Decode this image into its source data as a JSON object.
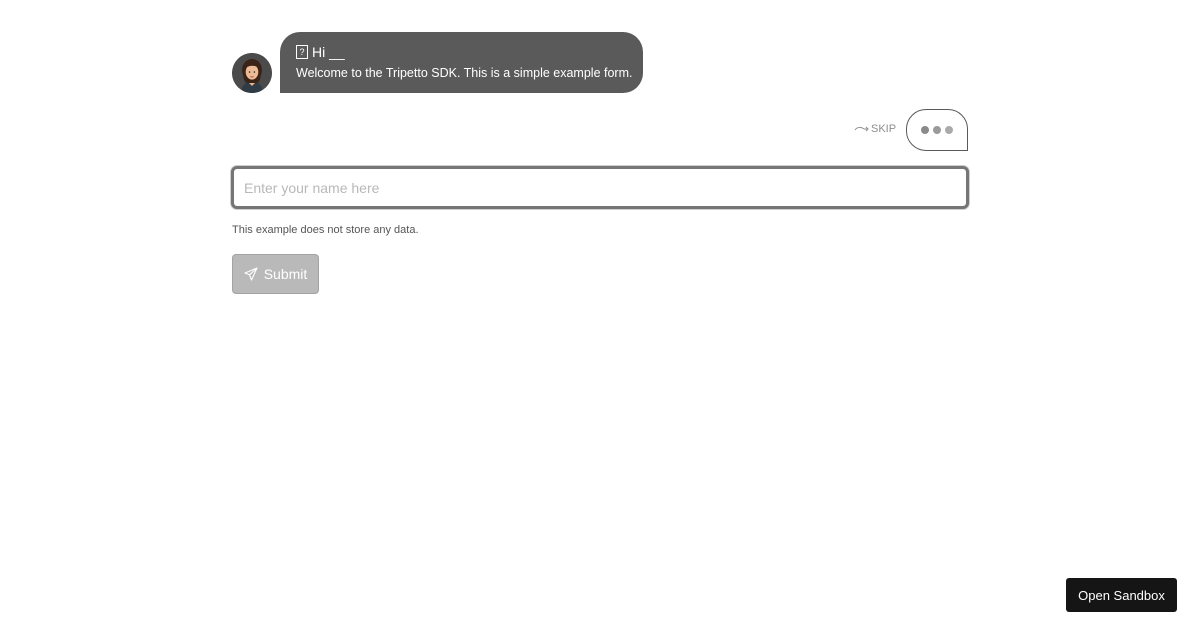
{
  "bot": {
    "avatar_icon": "woman-avatar-icon",
    "help_icon": "question-box-icon",
    "greeting": "Hi __",
    "message": "Welcome to the Tripetto SDK. This is a simple example form."
  },
  "skip": {
    "icon": "skip-arrow-icon",
    "label": "SKIP"
  },
  "typing_indicator": {
    "icon": "typing-dots-icon"
  },
  "name_field": {
    "value": "",
    "placeholder": "Enter your name here"
  },
  "note": "This example does not store any data.",
  "submit": {
    "icon": "paper-plane-icon",
    "label": "Submit"
  },
  "sandbox_button": {
    "label": "Open Sandbox"
  },
  "colors": {
    "bubble": "#5a5a5a",
    "submit_disabled": "#b9b9b9",
    "sandbox": "#151515",
    "input_border": "#767676"
  }
}
